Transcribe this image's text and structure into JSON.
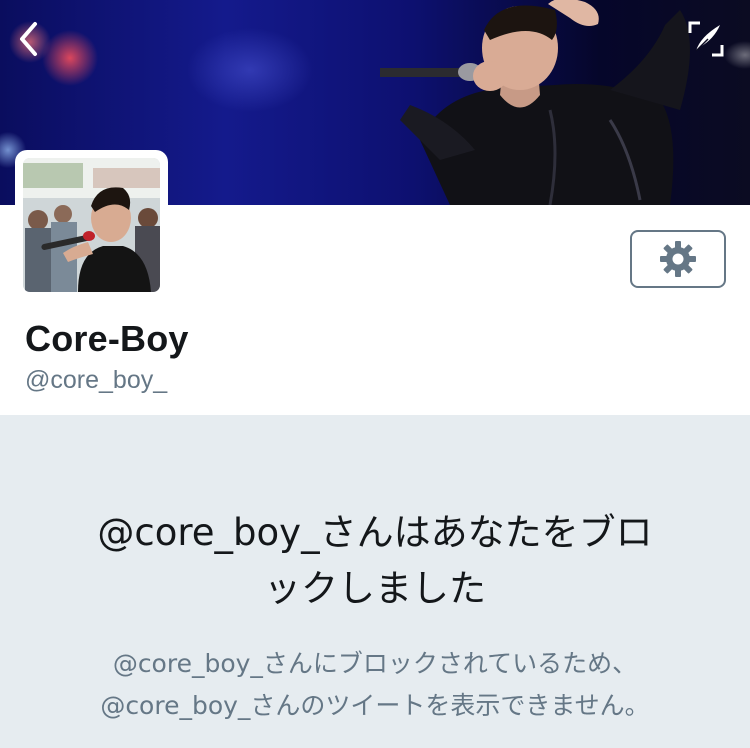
{
  "header": {
    "back_icon": "chevron-left-icon",
    "compose_icon": "compose-tweet-icon"
  },
  "profile": {
    "display_name": "Core-Boy",
    "screen_name": "@core_boy_",
    "settings_icon": "gear-icon"
  },
  "blocked_notice": {
    "title_line1": "@core_boy_さんはあなたをブロ",
    "title_line2": "ックしました",
    "subtitle_line1": "@core_boy_さんにブロックされているため、",
    "subtitle_line2": "@core_boy_さんのツイートを表示できません。"
  },
  "colors": {
    "primary_text": "#14171a",
    "secondary_text": "#657786",
    "background": "#e6ecf0",
    "banner_blue": "#141a8c"
  }
}
